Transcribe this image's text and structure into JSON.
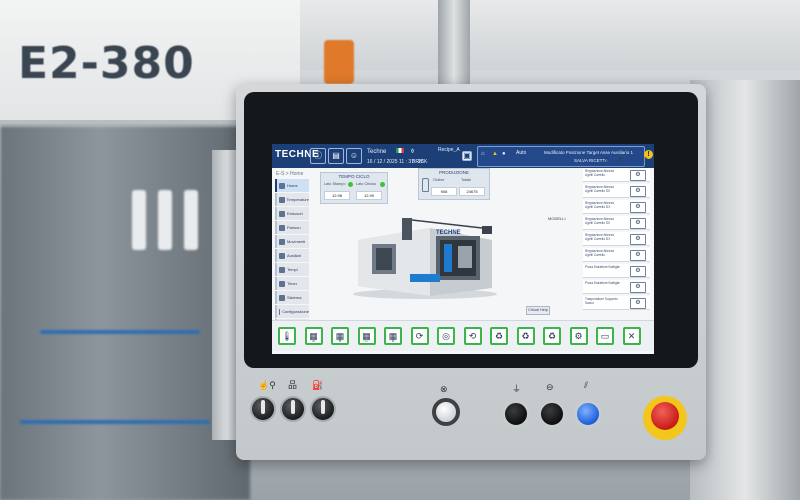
{
  "machine": {
    "model_label": "E2-380"
  },
  "header": {
    "logo": "TECHNE",
    "user": "Techne",
    "datetime": "16 / 12 / 2025   11 : 37 : 28",
    "recipe_label": "Recipe_A",
    "shift_label": "BRICK",
    "mode_label": "Auto",
    "message_title": "Modificato Posizione Target  Asse Ausiliario 1",
    "message_sub": "SALVA RICETTA",
    "warning_symbol": "!"
  },
  "breadcrumb": "E-S > Home",
  "sidebar": {
    "items": [
      {
        "label": "Home",
        "active": true
      },
      {
        "label": "Temperature"
      },
      {
        "label": "Estrusori"
      },
      {
        "label": "Parison"
      },
      {
        "label": "Movimenti"
      },
      {
        "label": "Ausiliari"
      },
      {
        "label": "Tempi"
      },
      {
        "label": "Timer"
      },
      {
        "label": "Sistema"
      },
      {
        "label": "Configurazione"
      },
      {
        "label": "Report"
      }
    ]
  },
  "cycle_card": {
    "title": "TEMPO CICLO",
    "left_label": "Lato Stampo",
    "left_value": "12.98",
    "right_label": "Lato Chiuso",
    "right_value": "12.99"
  },
  "production_card": {
    "title": "PRODUZIONE",
    "left_label": "Ordine",
    "left_value": "908",
    "right_label": "Totale",
    "right_value": "24675"
  },
  "render": {
    "brand": "TECHNE"
  },
  "right_panel": {
    "section_label": "MODELLI",
    "rows": [
      "Regolazione Altezza Ugelli Carrello",
      "Regolazione Altezza Ugelli Carrello SX",
      "Regolazione Altezza Ugelli Carrello DX",
      "Regolazione Altezza Ugelli Carrello SX",
      "Regolazione Altezza Ugelli Carrello DX",
      "Regolazione Altezza Ugelli Carrello",
      "Pinza Estrattore Bottiglie",
      "Pinza Estrattore Bottiglie",
      "Trasportatore Supporto Sacco"
    ],
    "close_label": "Chiudi Help"
  },
  "bottom_buttons": [
    {
      "icon": "🌡",
      "sub": ""
    },
    {
      "icon": "▦",
      "sub": "A"
    },
    {
      "icon": "▦",
      "sub": "B"
    },
    {
      "icon": "▦",
      "sub": "C"
    },
    {
      "icon": "▦",
      "sub": "D"
    },
    {
      "icon": "⟳",
      "sub": ""
    },
    {
      "icon": "◎",
      "sub": ""
    },
    {
      "icon": "⟲",
      "sub": ""
    },
    {
      "icon": "♻",
      "sub": ""
    },
    {
      "icon": "♻",
      "sub": ""
    },
    {
      "icon": "♻",
      "sub": ""
    },
    {
      "icon": "⚙",
      "sub": ""
    },
    {
      "icon": "▭",
      "sub": ""
    },
    {
      "icon": "✕",
      "sub": ""
    }
  ],
  "colors": {
    "header_bg": "#1c3f78",
    "button_border": "#3bb54a",
    "estop_red": "#c81b16",
    "estop_ring": "#f3c61c",
    "blue_button": "#1b5fd8"
  }
}
